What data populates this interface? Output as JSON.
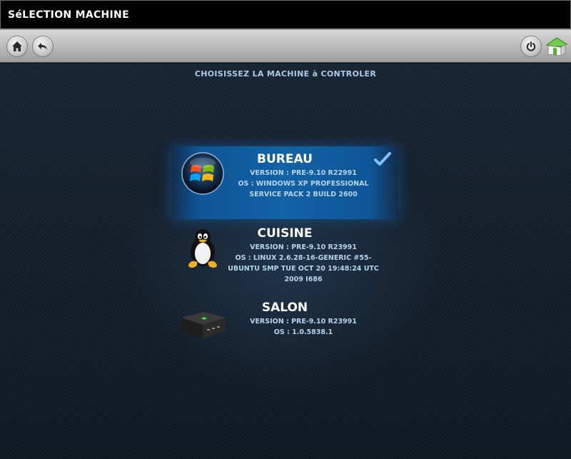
{
  "window": {
    "title": "SéLECTION MACHINE"
  },
  "toolbar": {
    "home_icon": "home-icon",
    "back_icon": "back-arrow-icon",
    "power_icon": "power-icon",
    "house_icon": "green-house-icon"
  },
  "main": {
    "heading": "CHOISISSEZ LA MACHINE à CONTROLER",
    "machines": [
      {
        "name": "BUREAU",
        "version": "VERSION : PRE-9.10 R22991",
        "os": "OS : WINDOWS XP PROFESSIONAL SERVICE PACK 2 BUILD 2600",
        "icon": "windows-logo-icon",
        "selected": true
      },
      {
        "name": "CUISINE",
        "version": "VERSION : PRE-9.10 R23991",
        "os": "OS : LINUX 2.6.28-16-GENERIC #55-UBUNTU SMP TUE OCT 20 19:48:24 UTC 2009 I686",
        "icon": "tux-penguin-icon",
        "selected": false
      },
      {
        "name": "SALON",
        "version": "VERSION : PRE-9.10 R23991",
        "os": "OS : 1.0.5838.1",
        "icon": "xbox-console-icon",
        "selected": false
      }
    ]
  },
  "colors": {
    "selected_bg": "#1262a6",
    "text_primary": "#ffffff",
    "text_secondary": "#b7d3ea",
    "background": "#0e1722"
  }
}
